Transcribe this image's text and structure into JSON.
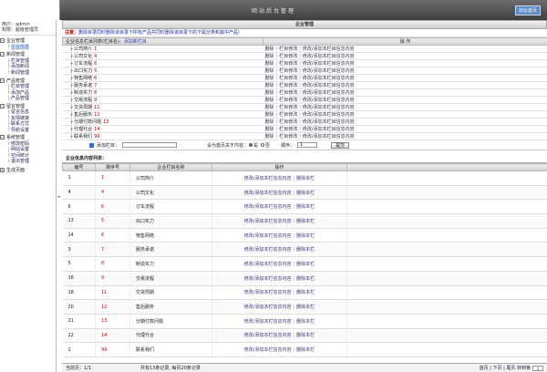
{
  "header": {
    "title": "网站后台管理",
    "home_label": "前台首页"
  },
  "user": {
    "line1": "用户：admin",
    "line2": "权限：超级管理员"
  },
  "sidebar": [
    {
      "label": "企业管理",
      "items": [
        "企业信息"
      ]
    },
    {
      "label": "新闻管理",
      "items": [
        "栏目管理",
        "添加新闻",
        "新闻管理"
      ]
    },
    {
      "label": "产品管理",
      "items": [
        "栏目管理",
        "添加产品",
        "产品管理"
      ]
    },
    {
      "label": "留言管理",
      "items": [
        "留言信息",
        "友情链接",
        "联系方式",
        "导航设置"
      ]
    },
    {
      "label": "系统管理",
      "items": [
        "修改密码",
        "网站设置",
        "空间统计",
        "退出管理"
      ]
    }
  ],
  "sidebar_single": "生成页面",
  "main": {
    "section_title": "企业管理",
    "notice_prefix": "注意：",
    "notice_text": "删除目录同时删除该目录下所有产品并同时删除该目录下的下属分类和其中产品!",
    "table1": {
      "header_left": "企业信息栏目列表(栏目名)：",
      "header_link": "添加新栏目",
      "header_ops": "操 作",
      "op_delete": "删除",
      "op_edit": "栏目修改",
      "op_content": "修改/添加本栏目信息内容",
      "rows": [
        {
          "name": "公司简介",
          "id": "1"
        },
        {
          "name": "公司文化",
          "id": "4"
        },
        {
          "name": "订车流程",
          "id": "6"
        },
        {
          "name": "出口实力",
          "id": "5"
        },
        {
          "name": "物售网络",
          "id": "6"
        },
        {
          "name": "服务承诺",
          "id": "7"
        },
        {
          "name": "制造实力",
          "id": "8"
        },
        {
          "name": "交易流程",
          "id": "9"
        },
        {
          "name": "交货周期",
          "id": "11"
        },
        {
          "name": "售后服务",
          "id": "12"
        },
        {
          "name": "分期付款问题",
          "id": "13"
        },
        {
          "name": "代理代合",
          "id": "14"
        },
        {
          "name": "联系我们",
          "id": "99"
        }
      ]
    },
    "addrow": {
      "label": "添加栏目：",
      "mid": "设为首页关于内容：",
      "yes": "是",
      "no": "否",
      "order": "顺序：",
      "order_value": "1",
      "submit": "提交"
    },
    "table2": {
      "section_label": "企业信息内容列表：",
      "headers": [
        "编号",
        "排序号",
        "企业栏目名称",
        "操作"
      ],
      "op_content": "修改/添加本栏信息内容",
      "op_delete": "删除本栏",
      "rows": [
        {
          "id": "1",
          "order": "1",
          "name": "公司简介"
        },
        {
          "id": "4",
          "order": "4",
          "name": "公司文化"
        },
        {
          "id": "6",
          "order": "6",
          "name": "订车流程"
        },
        {
          "id": "13",
          "order": "5",
          "name": "出口实力"
        },
        {
          "id": "14",
          "order": "6",
          "name": "物售网络"
        },
        {
          "id": "3",
          "order": "7",
          "name": "服务承诺"
        },
        {
          "id": "5",
          "order": "8",
          "name": "制造实力"
        },
        {
          "id": "16",
          "order": "9",
          "name": "交易流程"
        },
        {
          "id": "18",
          "order": "11",
          "name": "交货周期"
        },
        {
          "id": "20",
          "order": "12",
          "name": "售后服务"
        },
        {
          "id": "21",
          "order": "13",
          "name": "分期付款问题"
        },
        {
          "id": "22",
          "order": "14",
          "name": "代理代合"
        },
        {
          "id": "2",
          "order": "99",
          "name": "联系我们"
        }
      ]
    },
    "footer": {
      "page": "当前页：1/1",
      "count": "共有13条记录, 每页20条记录",
      "nav": "首页 | 下页 | 尾页 转到第",
      "select": "1"
    }
  }
}
